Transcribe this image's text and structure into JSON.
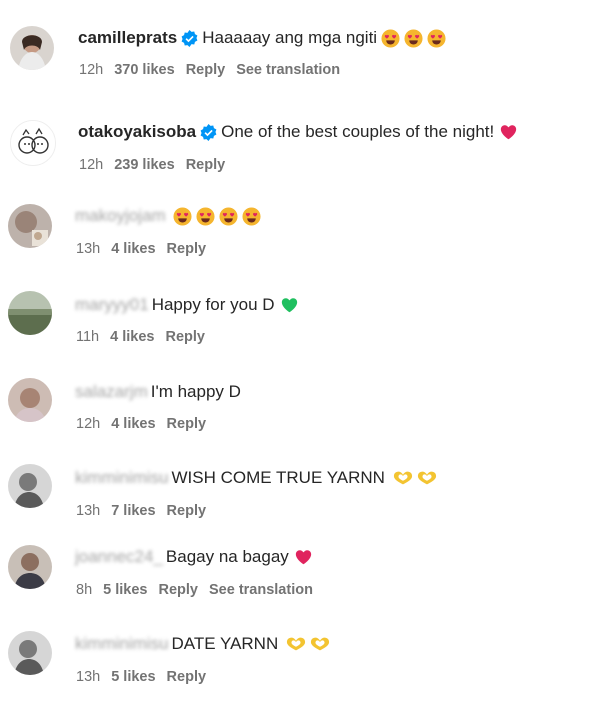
{
  "comments": [
    {
      "username": "camilleprats",
      "verified": true,
      "text": "Haaaaay ang mga ngiti",
      "time": "12h",
      "likes": "370 likes",
      "reply": "Reply",
      "translation": "See translation",
      "emoji": [
        "smiling-heart-eyes",
        "smiling-heart-eyes",
        "smiling-heart-eyes"
      ],
      "blurred": false
    },
    {
      "username": "otakoyakisoba",
      "verified": true,
      "text": "One of the best couples of the night!",
      "time": "12h",
      "likes": "239 likes",
      "reply": "Reply",
      "translation": "",
      "emoji": [
        "red-heart"
      ],
      "blurred": false
    },
    {
      "username": "makoyjojam",
      "verified": false,
      "text": "",
      "time": "13h",
      "likes": "4 likes",
      "reply": "Reply",
      "translation": "",
      "emoji": [
        "smiling-heart-eyes",
        "smiling-heart-eyes",
        "smiling-heart-eyes",
        "smiling-heart-eyes"
      ],
      "blurred": true
    },
    {
      "username": "maryyy01",
      "verified": false,
      "text": "Happy for you D",
      "time": "11h",
      "likes": "4 likes",
      "reply": "Reply",
      "translation": "",
      "emoji": [
        "green-heart"
      ],
      "blurred": true
    },
    {
      "username": "salazarjm",
      "verified": false,
      "text": "I'm happy D",
      "time": "12h",
      "likes": "4 likes",
      "reply": "Reply",
      "translation": "",
      "emoji": [],
      "blurred": true
    },
    {
      "username": "kimminimisu",
      "verified": false,
      "text": "WISH COME TRUE YARNN",
      "time": "13h",
      "likes": "7 likes",
      "reply": "Reply",
      "translation": "",
      "emoji": [
        "heart-hands",
        "heart-hands"
      ],
      "blurred": true
    },
    {
      "username": "joannec24_",
      "verified": false,
      "text": "Bagay na bagay",
      "time": "8h",
      "likes": "5 likes",
      "reply": "Reply",
      "translation": "See translation",
      "emoji": [
        "red-heart"
      ],
      "blurred": true
    },
    {
      "username": "kimminimisu",
      "verified": false,
      "text": "DATE YARNN",
      "time": "13h",
      "likes": "5 likes",
      "reply": "Reply",
      "translation": "",
      "emoji": [
        "heart-hands",
        "heart-hands"
      ],
      "blurred": true
    }
  ],
  "colors": {
    "text": "#262626",
    "meta": "#737373",
    "verified": "#0095f6",
    "red_heart": "#e0245e",
    "green_heart": "#1fbf5f"
  }
}
